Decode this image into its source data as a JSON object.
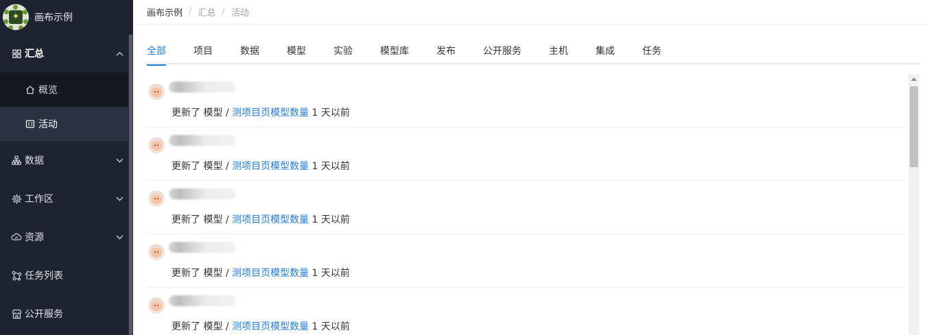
{
  "app": {
    "name": "画布示例"
  },
  "sidebar": {
    "items": [
      {
        "label": "汇总",
        "icon": "grid-icon",
        "open": true,
        "children": [
          {
            "label": "概览",
            "icon": "home-icon",
            "active": false
          },
          {
            "label": "活动",
            "icon": "activity-icon",
            "active": true
          }
        ]
      },
      {
        "label": "数据",
        "icon": "sitemap-icon"
      },
      {
        "label": "工作区",
        "icon": "chip-icon"
      },
      {
        "label": "资源",
        "icon": "cloud-icon"
      },
      {
        "label": "任务列表",
        "icon": "share-icon"
      },
      {
        "label": "公开服务",
        "icon": "store-icon"
      }
    ]
  },
  "breadcrumb": [
    "画布示例",
    "汇总",
    "活动"
  ],
  "tabs": [
    {
      "label": "全部",
      "active": true
    },
    {
      "label": "项目"
    },
    {
      "label": "数据"
    },
    {
      "label": "模型"
    },
    {
      "label": "实验"
    },
    {
      "label": "模型库"
    },
    {
      "label": "发布"
    },
    {
      "label": "公开服务"
    },
    {
      "label": "主机"
    },
    {
      "label": "集成"
    },
    {
      "label": "任务"
    }
  ],
  "activities": [
    {
      "verb": "更新了",
      "type": "模型",
      "separator": "/",
      "target": "测项目页模型数量",
      "time": "1 天以前"
    },
    {
      "verb": "更新了",
      "type": "模型",
      "separator": "/",
      "target": "测项目页模型数量",
      "time": "1 天以前"
    },
    {
      "verb": "更新了",
      "type": "模型",
      "separator": "/",
      "target": "测项目页模型数量",
      "time": "1 天以前"
    },
    {
      "verb": "更新了",
      "type": "模型",
      "separator": "/",
      "target": "测项目页模型数量",
      "time": "1 天以前"
    },
    {
      "verb": "更新了",
      "type": "模型",
      "separator": "/",
      "target": "测项目页模型数量",
      "time": "1 天以前"
    }
  ],
  "colors": {
    "sidebar_bg": "#1f2330",
    "accent": "#1f7cd9",
    "active_item_bg": "#2c3242"
  }
}
